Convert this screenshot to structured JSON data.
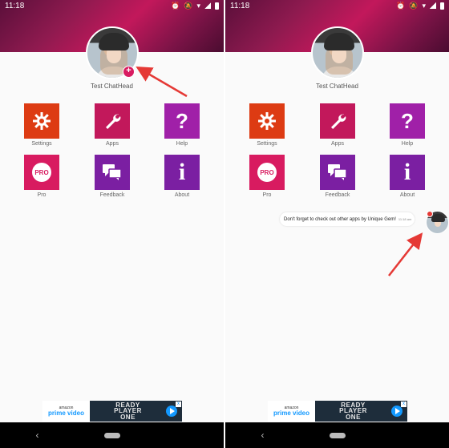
{
  "status_bar": {
    "time": "11:18"
  },
  "profile": {
    "name": "Test ChatHead"
  },
  "menu": [
    {
      "label": "Settings",
      "icon": "gear-icon"
    },
    {
      "label": "Apps",
      "icon": "wrench-icon"
    },
    {
      "label": "Help",
      "icon": "question-icon",
      "glyph": "?"
    },
    {
      "label": "Pro",
      "icon": "pro-icon",
      "glyph": "PRO"
    },
    {
      "label": "Feedback",
      "icon": "chat-bubbles-icon"
    },
    {
      "label": "About",
      "icon": "info-icon",
      "glyph": "i"
    }
  ],
  "ad": {
    "brand_top": "amazon",
    "brand": "prime video",
    "title_line1": "READY",
    "title_line2": "PLAYER",
    "title_line3": "ONE",
    "close": "x"
  },
  "chathead": {
    "message": "Don't forget to check out other apps by Unique Gem!",
    "time": "11:18 am"
  },
  "colors": {
    "accent": "#d81b60",
    "arrow": "#e53935",
    "header": "#8e1a4f"
  }
}
